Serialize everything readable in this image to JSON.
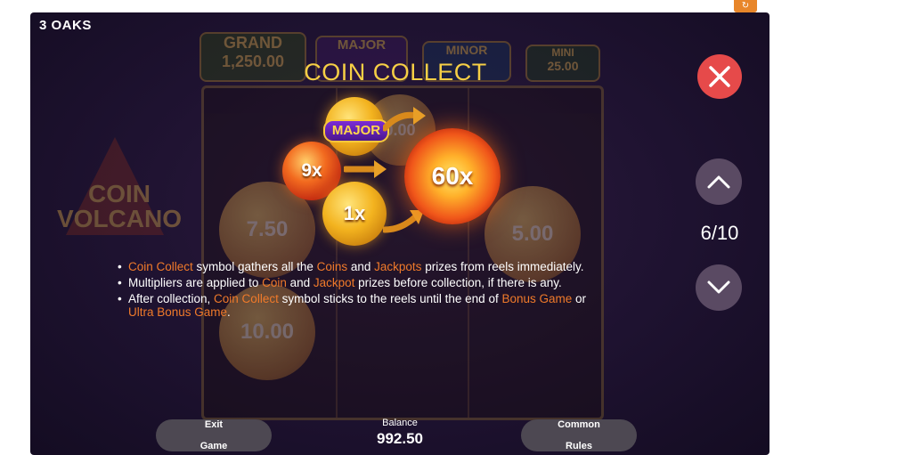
{
  "brand": "3 OAKS",
  "background": {
    "jackpots": [
      {
        "name": "GRAND",
        "value": "1,250.00"
      },
      {
        "name": "MAJOR",
        "value": ""
      },
      {
        "name": "MINOR",
        "value": ""
      },
      {
        "name": "MINI",
        "value": "25.00"
      }
    ],
    "logo_line1": "COIN",
    "logo_line2": "VOLCANO",
    "coins": [
      "7.50",
      "5.00",
      "10.00",
      "0.00"
    ]
  },
  "title": "COIN COLLECT",
  "symbols": {
    "major_label": "MAJOR",
    "coin_9x": "9x",
    "coin_1x": "1x",
    "collect_value": "60x"
  },
  "rules": {
    "r1": {
      "a": "Coin Collect",
      "b": " symbol gathers all the ",
      "c": "Coins",
      "d": " and ",
      "e": "Jackpots",
      "f": " prizes from reels immediately."
    },
    "r2": {
      "a": "Multipliers are applied to ",
      "b": "Coin",
      "c": " and ",
      "d": "Jackpot",
      "e": " prizes before collection, if there is any."
    },
    "r3": {
      "a": "After collection, ",
      "b": "Coin Collect",
      "c": " symbol sticks to the reels until the end of ",
      "d": "Bonus Game",
      "e": " or",
      "f": "Ultra Bonus Game",
      "g": "."
    }
  },
  "pagination": "6/10",
  "footer": {
    "exit_line1": "Exit",
    "exit_line2": "Game",
    "balance_label": "Balance",
    "balance_value": "992.50",
    "rules_line1": "Common",
    "rules_line2": "Rules"
  },
  "colors": {
    "highlight": "#f07a2a",
    "title": "#f6cf45",
    "close": "#e64a4a",
    "button": "#5a4a63"
  },
  "icons": [
    "app-badge-icon",
    "close-icon",
    "chevron-up-icon",
    "chevron-down-icon",
    "arrow-icon"
  ]
}
